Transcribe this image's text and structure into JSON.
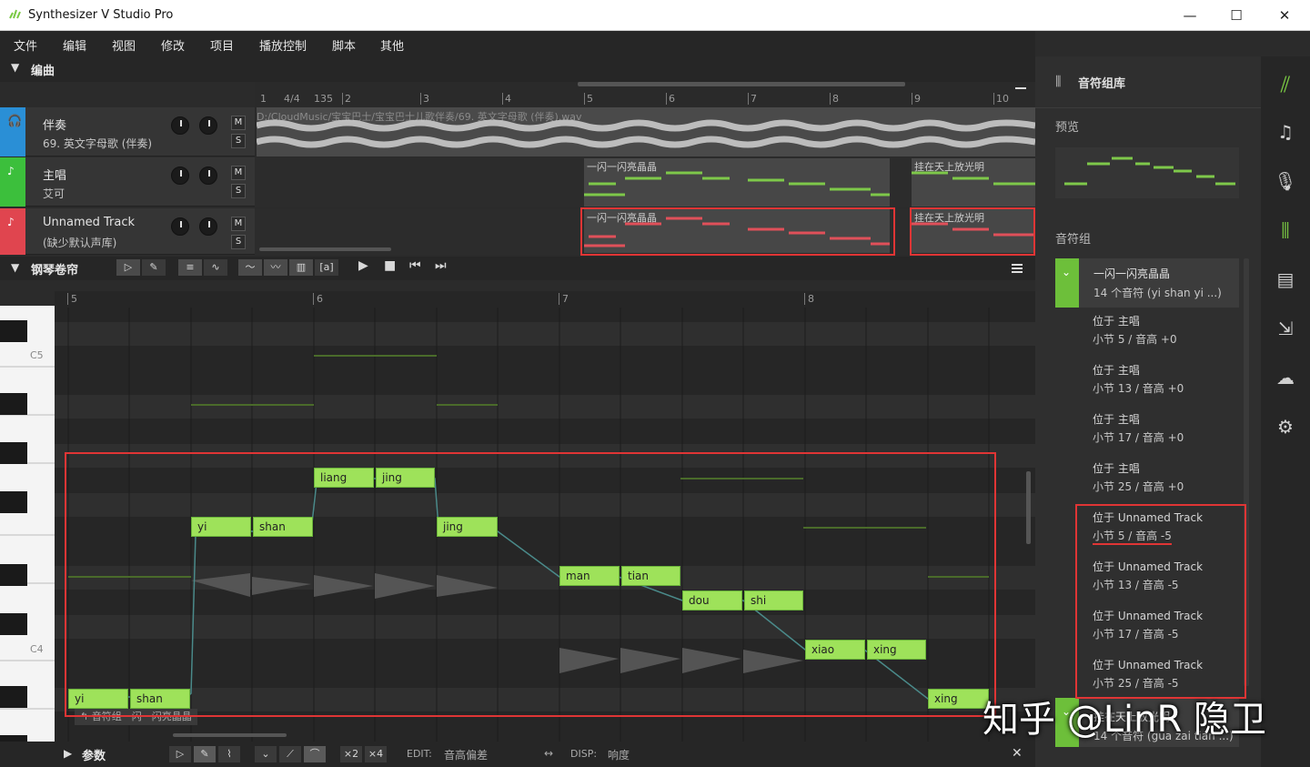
{
  "window": {
    "title": "Synthesizer V Studio Pro",
    "min": "—",
    "max": "☐",
    "close": "✕"
  },
  "menu": [
    "文件",
    "编辑",
    "视图",
    "修改",
    "项目",
    "播放控制",
    "脚本",
    "其他"
  ],
  "arrangement": {
    "header": "编曲",
    "ruler_marks": [
      "1",
      "4/4",
      "135",
      "2",
      "3",
      "4",
      "5",
      "6",
      "7",
      "8",
      "9",
      "10"
    ],
    "tracks": [
      {
        "name": "伴奏",
        "sub": "69. 英文字母歌 (伴奏)",
        "color": "#2a8fd6"
      },
      {
        "name": "主唱",
        "sub": "艾可",
        "color": "#3cbf3c"
      },
      {
        "name": "Unnamed Track",
        "sub": "(缺少默认声库)",
        "color": "#e0454f"
      }
    ],
    "audio_path": "D:/CloudMusic/宝宝巴士/宝宝巴士儿歌伴奏/69. 英文字母歌 (伴奏).wav",
    "clips": [
      "一闪一闪亮晶晶",
      "挂在天上放光明",
      "一闪一闪亮晶晶",
      "挂在天上放光明"
    ],
    "m_label": "M",
    "s_label": "S"
  },
  "piano_roll": {
    "header": "钢琴卷帘",
    "quant": "1/4",
    "ruler_marks": [
      "5",
      "6",
      "7",
      "8"
    ],
    "key_labels": [
      "C5",
      "C4"
    ],
    "group_label": "↰ 音符组　闪　闪亮晶晶",
    "notes": [
      "liang",
      "jing",
      "yi",
      "shan",
      "jing",
      "man",
      "tian",
      "dou",
      "shi",
      "xiao",
      "xing",
      "xing",
      "yi",
      "shan"
    ]
  },
  "params": {
    "header": "参数",
    "x2": "×2",
    "x4": "×4",
    "edit": "EDIT:",
    "edit_value": "音高偏差",
    "disp": "DISP:",
    "disp_value": "响度"
  },
  "library": {
    "title": "音符组库",
    "preview": "预览",
    "groups": "音符组",
    "group1": {
      "name": "一闪一闪亮晶晶",
      "sub": "14 个音符 (yi shan yi ...)"
    },
    "instances": [
      {
        "l1": "位于 主唱",
        "l2": "小节 5 / 音高 +0"
      },
      {
        "l1": "位于 主唱",
        "l2": "小节 13 / 音高 +0"
      },
      {
        "l1": "位于 主唱",
        "l2": "小节 17 / 音高 +0"
      },
      {
        "l1": "位于 主唱",
        "l2": "小节 25 / 音高 +0"
      },
      {
        "l1": "位于 Unnamed Track",
        "l2": "小节 5 / 音高 -5"
      },
      {
        "l1": "位于 Unnamed Track",
        "l2": "小节 13 / 音高 -5"
      },
      {
        "l1": "位于 Unnamed Track",
        "l2": "小节 17 / 音高 -5"
      },
      {
        "l1": "位于 Unnamed Track",
        "l2": "小节 25 / 音高 -5"
      }
    ],
    "group2": {
      "name": "挂在天上放光明",
      "sub": "14 个音符 (gua zai tian ...)"
    }
  },
  "watermark": "知乎 @LinR 隐卫"
}
